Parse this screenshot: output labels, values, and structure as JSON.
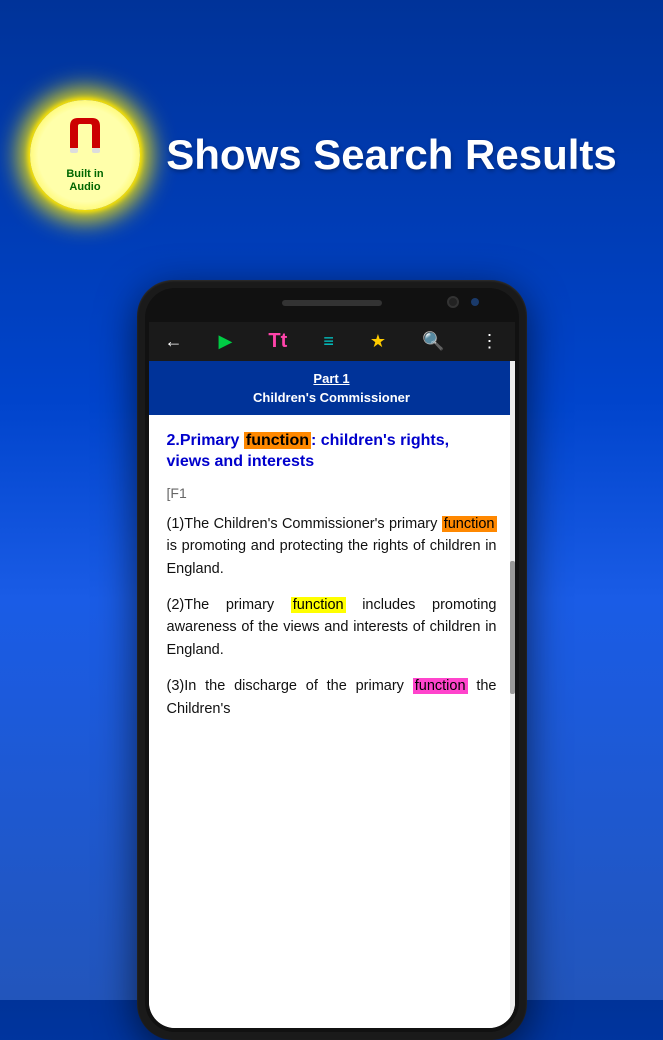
{
  "header": {
    "title": "Shows Search Results",
    "logo": {
      "line1": "Built in",
      "line2": "Audio"
    }
  },
  "toolbar": {
    "icons": [
      "←",
      "▶",
      "Tt",
      "≡",
      "★",
      "🔍",
      "⋮"
    ]
  },
  "screen": {
    "section_header": {
      "part": "Part 1",
      "subtitle": "Children's Commissioner"
    },
    "article": {
      "number": "2.",
      "title_before": "Primary ",
      "title_highlight": "function",
      "title_after": ": children's rights, views and interests"
    },
    "f1_bracket": "[F1",
    "paragraphs": [
      {
        "id": "para1",
        "label": "(1)",
        "text_before": "The Children's Commissioner's primary ",
        "highlight": "function",
        "highlight_type": "orange",
        "text_after": " is promoting and protecting the rights of children in England."
      },
      {
        "id": "para2",
        "label": "(2)",
        "text_before": "The primary ",
        "highlight": "function",
        "highlight_type": "yellow",
        "text_after": " includes promoting awareness of the views and interests of children in England."
      },
      {
        "id": "para3",
        "label": "(3)",
        "text_before": "In the discharge of the primary ",
        "highlight": "function",
        "highlight_type": "pink",
        "text_after": " the Children's"
      }
    ]
  }
}
